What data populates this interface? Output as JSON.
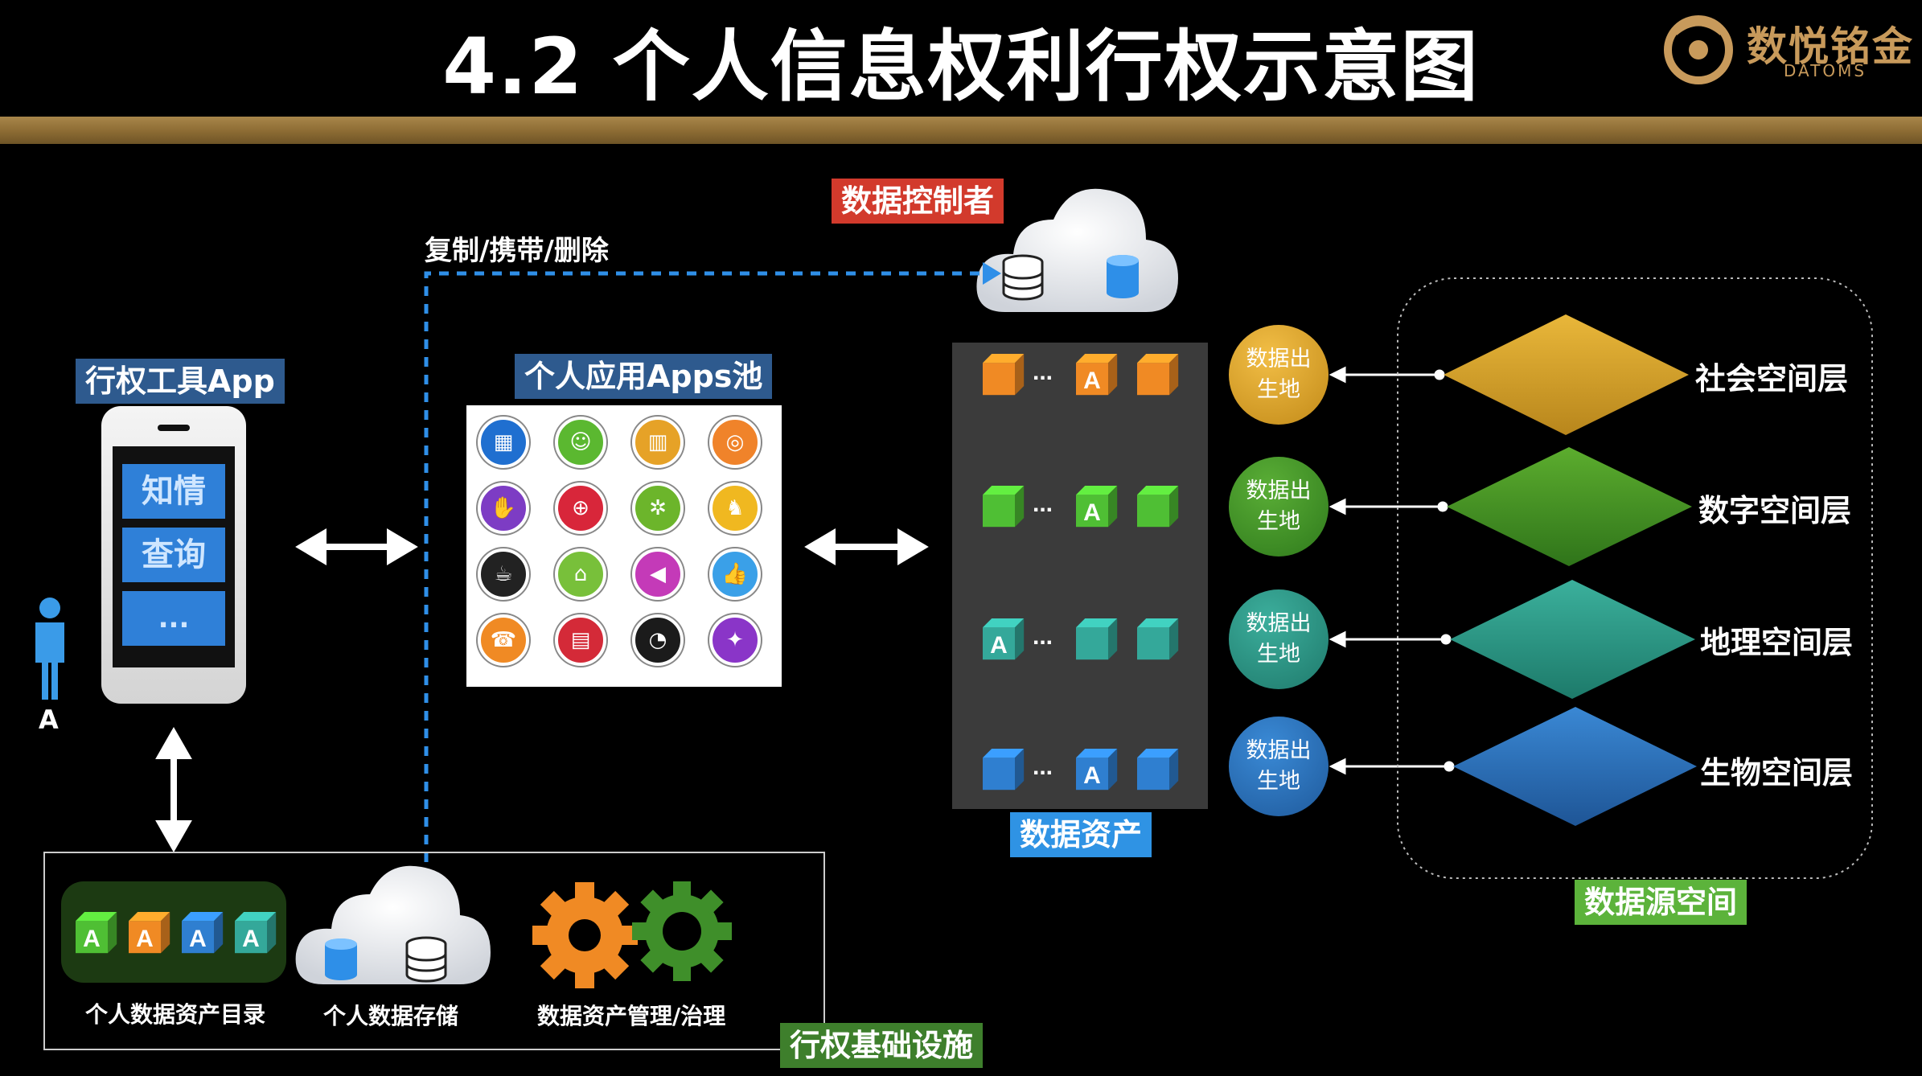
{
  "header": {
    "title": "4.2 个人信息权利行权示意图",
    "logo_name": "数悦铭金",
    "logo_sub": "DATOMS"
  },
  "controller": {
    "label": "数据控制者",
    "flow_label": "复制/携带/删除"
  },
  "tool_app": {
    "label": "行权工具App",
    "buttons": [
      "知情",
      "查询",
      "..."
    ],
    "person_label": "A"
  },
  "apps_pool": {
    "label": "个人应用Apps池",
    "icon_names": [
      "calculator-icon",
      "people-icon",
      "chart-icon",
      "target-icon",
      "handshake-icon",
      "globe-icon",
      "gears-icon",
      "chess-icon",
      "coffee-icon",
      "home-icon",
      "speaker-icon",
      "thumbs-up-icon",
      "phone-icon",
      "news-icon",
      "pie-chart-icon",
      "bulb-icon"
    ]
  },
  "data_assets": {
    "label": "数据资产",
    "row_colors": [
      "#f08a24",
      "#4fbf34",
      "#34a89a",
      "#2f7fd0"
    ],
    "ellipsis": "...",
    "marker": "A"
  },
  "data_origin": {
    "label": "数据出生地"
  },
  "layers": {
    "items": [
      {
        "name": "社会空间层",
        "color": "#d9a12a"
      },
      {
        "name": "数字空间层",
        "color": "#4e9a2a"
      },
      {
        "name": "地理空间层",
        "color": "#2d9c8a"
      },
      {
        "name": "生物空间层",
        "color": "#2a73b8"
      }
    ],
    "source_space_label": "数据源空间"
  },
  "infrastructure": {
    "label": "行权基础设施",
    "catalog_label": "个人数据资产目录",
    "storage_label": "个人数据存储",
    "governance_label": "数据资产管理/治理"
  }
}
